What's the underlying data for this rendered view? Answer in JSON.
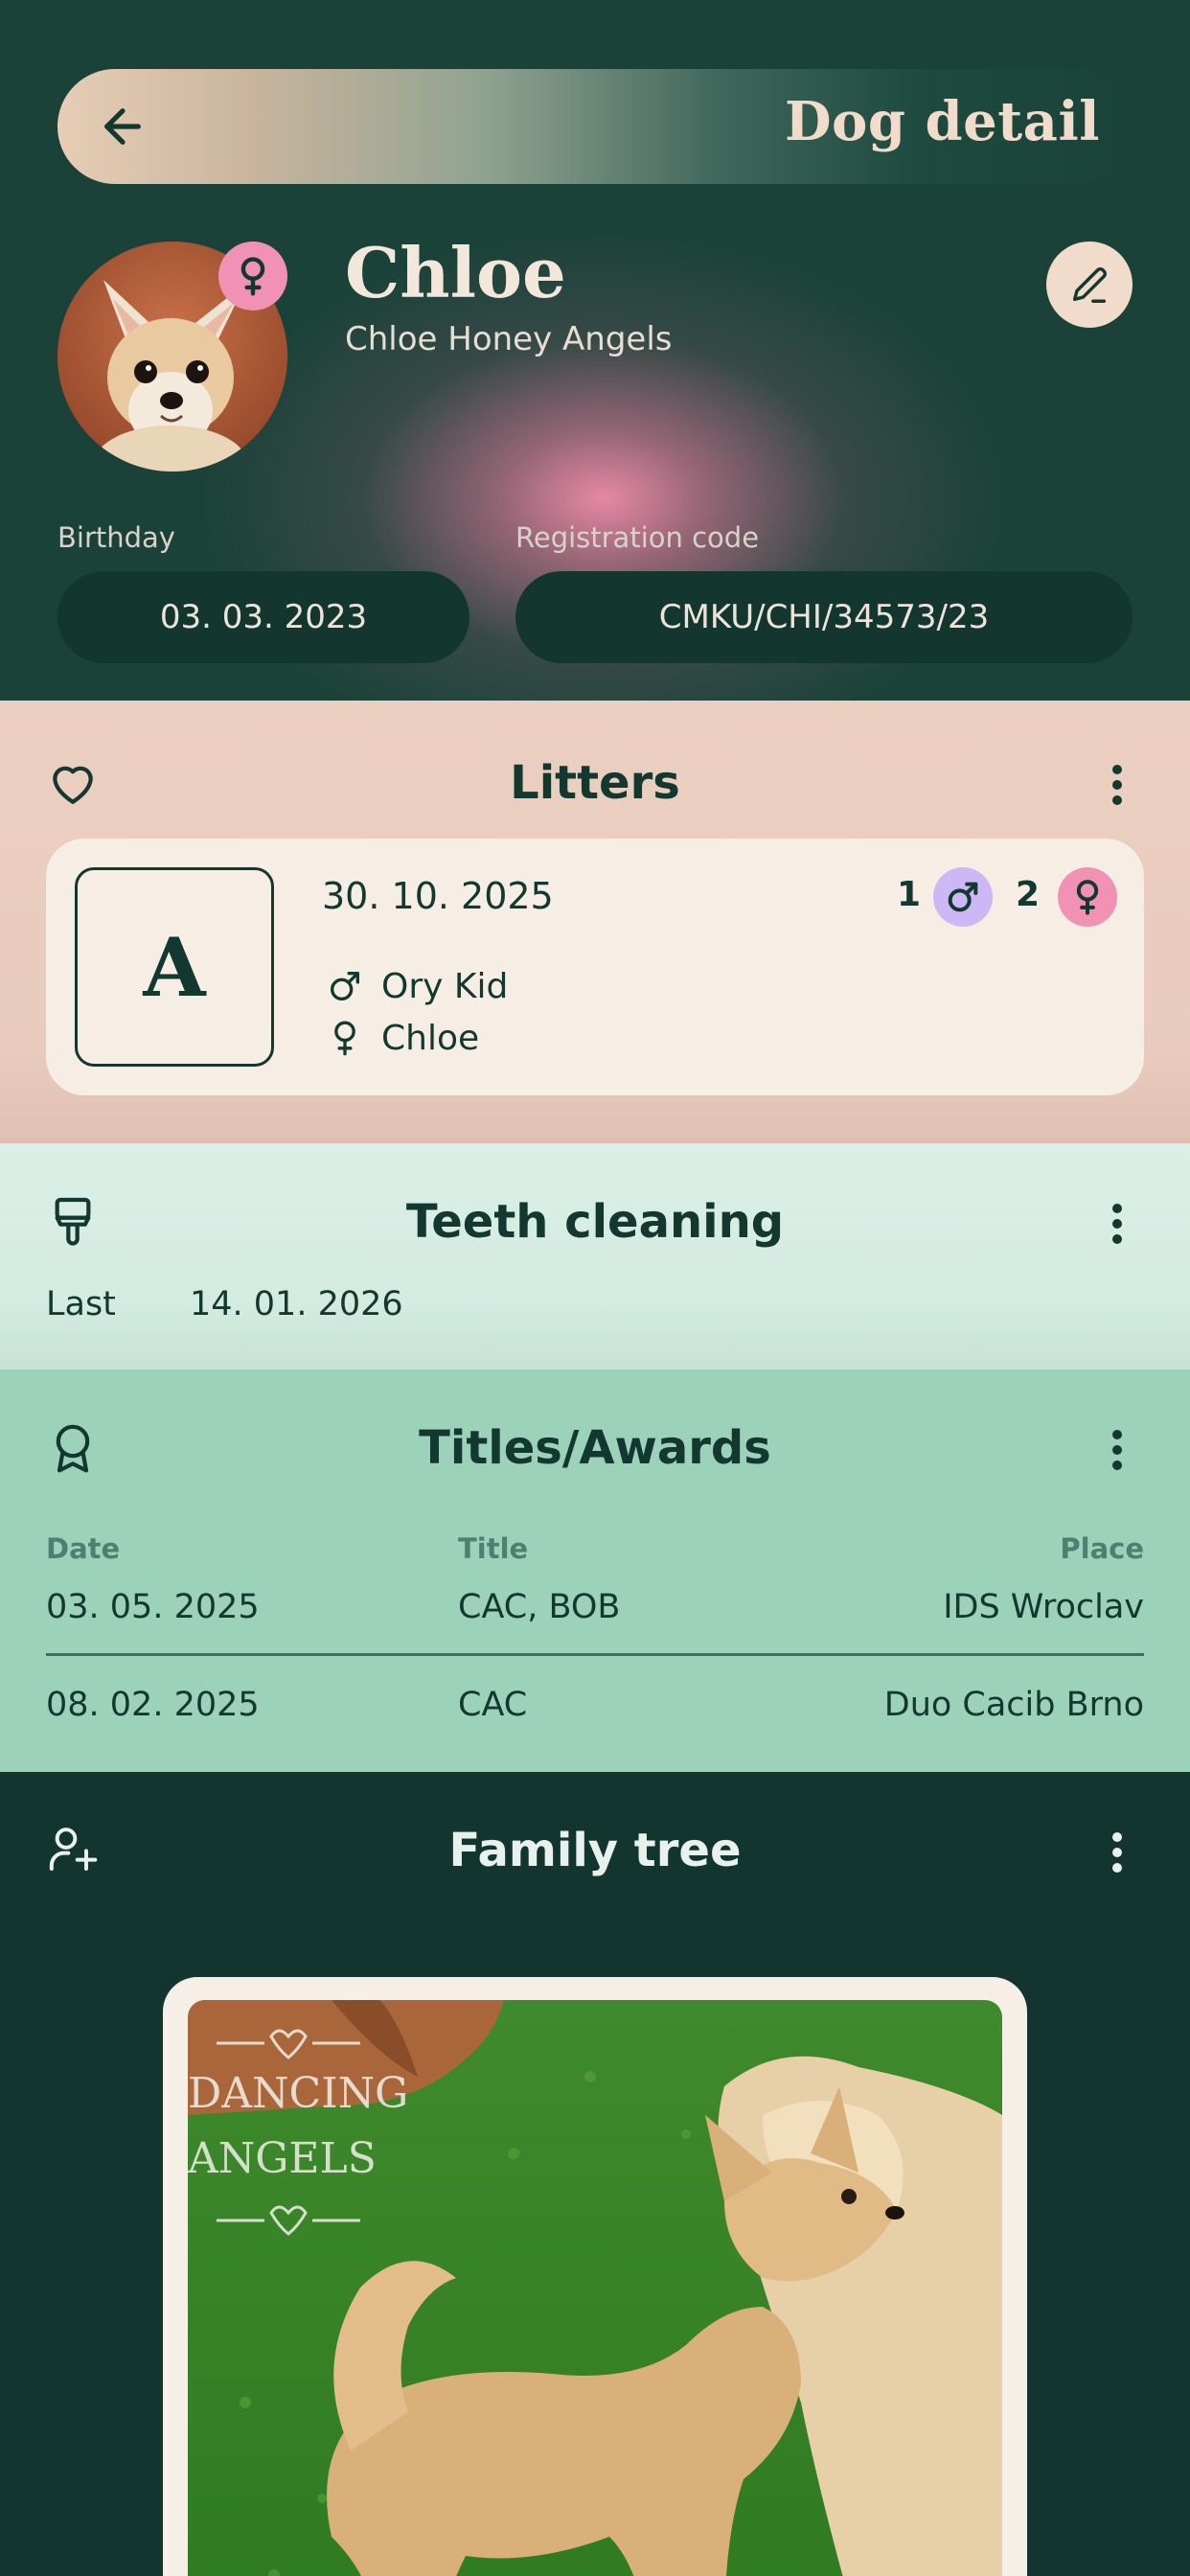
{
  "header": {
    "title": "Dog detail",
    "back_icon": "arrow-left-icon",
    "dog": {
      "name": "Chloe",
      "kennel_name": "Chloe Honey Angels",
      "sex": "female",
      "edit_icon": "pencil-icon"
    },
    "birthday_label": "Birthday",
    "birthday": "03. 03. 2023",
    "registration_label": "Registration code",
    "registration_code": "CMKU/CHI/34573/23"
  },
  "litters": {
    "title": "Litters",
    "icon": "heart-icon",
    "menu_icon": "more-vertical-icon",
    "items": [
      {
        "letter": "A",
        "date": "30. 10. 2025",
        "males": "1",
        "females": "2",
        "sire": "Ory Kid",
        "dam": "Chloe"
      }
    ]
  },
  "teeth_cleaning": {
    "title": "Teeth cleaning",
    "icon": "toothbrush-icon",
    "menu_icon": "more-vertical-icon",
    "last_label": "Last",
    "last_date": "14. 01. 2026"
  },
  "awards": {
    "title": "Titles/Awards",
    "icon": "award-ribbon-icon",
    "menu_icon": "more-vertical-icon",
    "columns": [
      "Date",
      "Title",
      "Place"
    ],
    "rows": [
      {
        "date": "03. 05. 2025",
        "title": "CAC, BOB",
        "place": "IDS Wroclav"
      },
      {
        "date": "08. 02. 2025",
        "title": "CAC",
        "place": "Duo Cacib Brno"
      }
    ]
  },
  "family_tree": {
    "title": "Family tree",
    "icon": "user-plus-icon",
    "menu_icon": "more-vertical-icon",
    "photo_watermark": [
      "DANCING",
      "ANGELS"
    ]
  },
  "colors": {
    "header_bg": "#1a4239",
    "accent_cream": "#f1dccb",
    "female_pink": "#f191b3",
    "male_lilac": "#cbb8f5",
    "litters_bg": "#ebcfc1",
    "teeth_bg": "#dcefe6",
    "awards_bg": "#9cd2ba",
    "dark_green": "#12362f"
  }
}
